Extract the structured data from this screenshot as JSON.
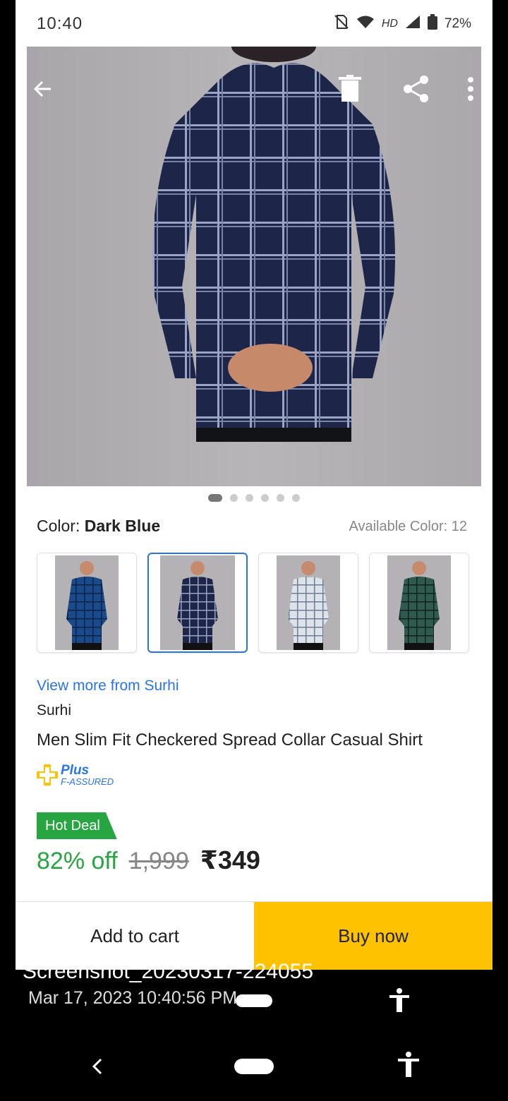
{
  "status_bar": {
    "time": "10:40",
    "network": "HD",
    "battery": "72%"
  },
  "hero": {
    "active_image_index": 0,
    "image_count": 6
  },
  "color": {
    "label": "Color:",
    "value": "Dark Blue",
    "available": "Available Color: 12"
  },
  "variants": [
    {
      "name": "blue-check"
    },
    {
      "name": "dark-blue-check",
      "selected": true
    },
    {
      "name": "grey-check"
    },
    {
      "name": "green-check"
    }
  ],
  "product": {
    "view_more": "View more from Surhi",
    "brand": "Surhi",
    "title": "Men Slim Fit Checkered Spread Collar Casual Shirt",
    "assured_plus": "Plus",
    "assured_sub": "F-ASSURED"
  },
  "deal": {
    "tag": "Hot Deal",
    "discount": "82% off",
    "mrp": "1,999",
    "price": "₹349"
  },
  "actions": {
    "add_to_cart": "Add to cart",
    "buy_now": "Buy now"
  },
  "screenshot": {
    "filename": "Screenshot_20230317-224055",
    "date": "Mar 17, 2023 10:40:56 PM"
  },
  "colors": {
    "accent": "#2874f0",
    "green": "#26a541",
    "buy": "#ffc200"
  }
}
